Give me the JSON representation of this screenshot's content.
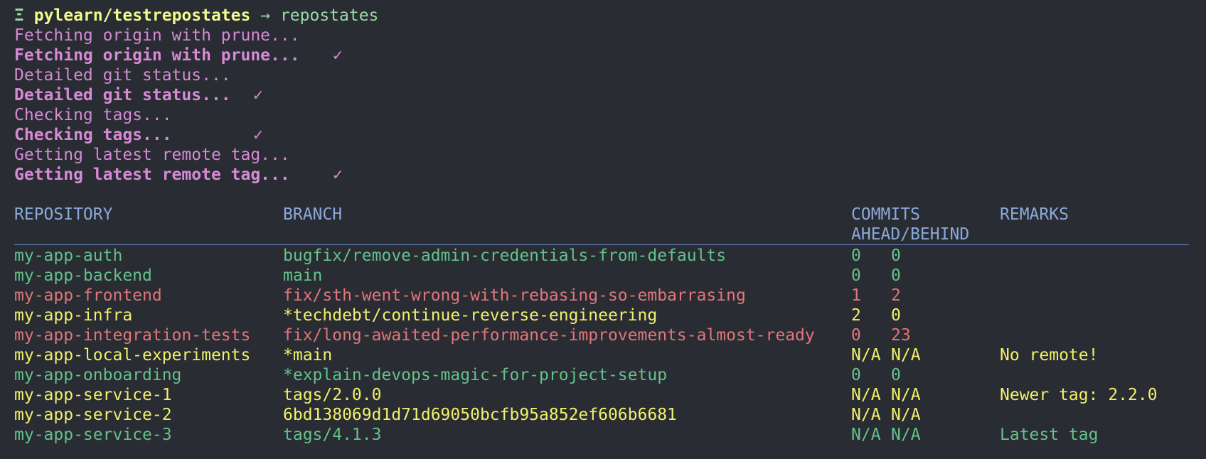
{
  "prompt": {
    "icon": "Ξ",
    "path": "pylearn/testrepostates",
    "arrow": "→",
    "command": "repostates"
  },
  "progress": [
    {
      "text": "Fetching origin with prune...",
      "done": false
    },
    {
      "text": "Fetching origin with prune...",
      "done": true,
      "check": "✓"
    },
    {
      "text": "Detailed git status...",
      "done": false
    },
    {
      "text": "Detailed git status...",
      "done": true,
      "check": "✓"
    },
    {
      "text": "Checking tags...",
      "done": false
    },
    {
      "text": "Checking tags...",
      "done": true,
      "check": "✓"
    },
    {
      "text": "Getting latest remote tag...",
      "done": false
    },
    {
      "text": "Getting latest remote tag...",
      "done": true,
      "check": "✓"
    }
  ],
  "table": {
    "headers": {
      "repository": "REPOSITORY",
      "branch": "BRANCH",
      "commits_line1": "COMMITS",
      "commits_line2": "AHEAD/BEHIND",
      "remarks": "REMARKS"
    },
    "rows": [
      {
        "repo": "my-app-auth",
        "branch": "bugfix/remove-admin-credentials-from-defaults",
        "ahead": "0",
        "behind": "0",
        "remarks": "",
        "color": "#63c28a",
        "remarks_color": ""
      },
      {
        "repo": "my-app-backend",
        "branch": "main",
        "ahead": "0",
        "behind": "0",
        "remarks": "",
        "color": "#63c28a",
        "remarks_color": ""
      },
      {
        "repo": "my-app-frontend",
        "branch": "fix/sth-went-wrong-with-rebasing-so-embarrasing",
        "ahead": "1",
        "behind": "2",
        "remarks": "",
        "color": "#e0767a",
        "remarks_color": ""
      },
      {
        "repo": "my-app-infra",
        "branch": "*techdebt/continue-reverse-engineering",
        "ahead": "2",
        "behind": "0",
        "remarks": "",
        "color": "#f1f06b",
        "remarks_color": ""
      },
      {
        "repo": "my-app-integration-tests",
        "branch": "fix/long-awaited-performance-improvements-almost-ready",
        "ahead": "0",
        "behind": "23",
        "remarks": "",
        "color": "#e0767a",
        "remarks_color": ""
      },
      {
        "repo": "my-app-local-experiments",
        "branch": "*main",
        "ahead": "N/A",
        "behind": "N/A",
        "remarks": "No remote!",
        "color": "#f1f06b",
        "remarks_color": "#f1f06b"
      },
      {
        "repo": "my-app-onboarding",
        "branch": "*explain-devops-magic-for-project-setup",
        "ahead": "0",
        "behind": "0",
        "remarks": "",
        "color": "#63c28a",
        "remarks_color": ""
      },
      {
        "repo": "my-app-service-1",
        "branch": "tags/2.0.0",
        "ahead": "N/A",
        "behind": "N/A",
        "remarks": "Newer tag: 2.2.0",
        "color": "#f1f06b",
        "remarks_color": "#f1f06b"
      },
      {
        "repo": "my-app-service-2",
        "branch": "6bd138069d1d71d69050bcfb95a852ef606b6681",
        "ahead": "N/A",
        "behind": "N/A",
        "remarks": "",
        "color": "#f1f06b",
        "remarks_color": ""
      },
      {
        "repo": "my-app-service-3",
        "branch": "tags/4.1.3",
        "ahead": "N/A",
        "behind": "N/A",
        "remarks": "Latest tag",
        "color": "#63c28a",
        "remarks_color": "#63c28a"
      }
    ]
  }
}
